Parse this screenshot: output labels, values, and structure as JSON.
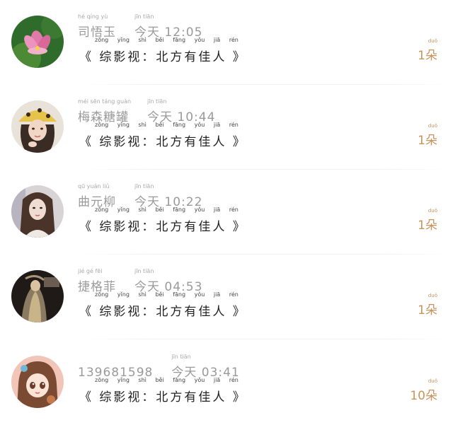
{
  "title_pinyin": "zōng yǐng shì   běi fāng yǒu jiā rén",
  "entries": [
    {
      "name": "司悟玉",
      "name_pinyin": "hé  qíng  yù",
      "time_pinyin": "jīn tiān",
      "time": "今天 12:05",
      "title": "《 综影视：北方有佳人 》",
      "count": "1朵",
      "count_pinyin": "duǒ",
      "avatar_icon": "lotus-flower-avatar-icon"
    },
    {
      "name": "梅森糖罐",
      "name_pinyin": "méi sēn táng guàn",
      "time_pinyin": "jīn tiān",
      "time": "今天 10:44",
      "title": "《 综影视：北方有佳人 》",
      "count": "1朵",
      "count_pinyin": "duǒ",
      "avatar_icon": "girl-hat-avatar-icon"
    },
    {
      "name": "曲元柳",
      "name_pinyin": "qū yuán liǔ",
      "time_pinyin": "jīn tiān",
      "time": "今天 10:22",
      "title": "《 综影视：北方有佳人 》",
      "count": "1朵",
      "count_pinyin": "duǒ",
      "avatar_icon": "girl-portrait-avatar-icon"
    },
    {
      "name": "捷格菲",
      "name_pinyin": "jié  gé  fēi",
      "time_pinyin": "jīn tiān",
      "time": "今天 04:53",
      "title": "《 综影视：北方有佳人 》",
      "count": "1朵",
      "count_pinyin": "duǒ",
      "avatar_icon": "dark-figure-avatar-icon"
    },
    {
      "name": "139681598",
      "name_pinyin": "",
      "time_pinyin": "jīn tiān",
      "time": "今天 03:41",
      "title": "《 综影视：北方有佳人 》",
      "count": "10朵",
      "count_pinyin": "duǒ",
      "avatar_icon": "cartoon-girl-avatar-icon"
    }
  ]
}
